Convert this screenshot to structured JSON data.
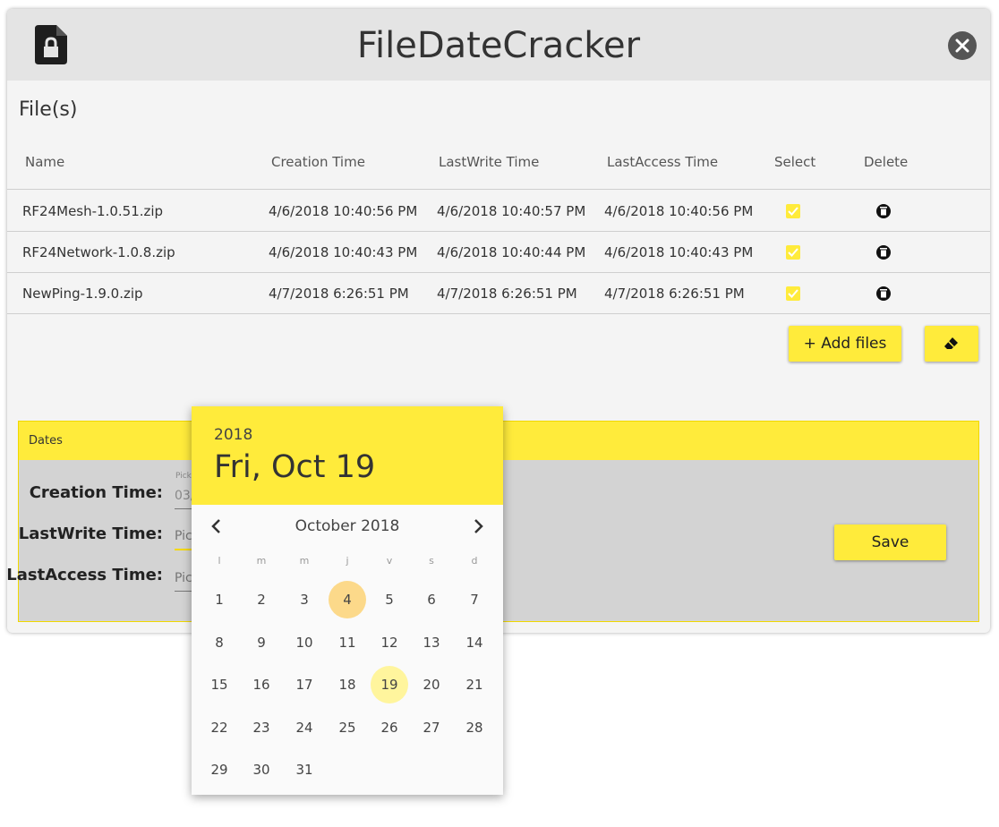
{
  "app": {
    "title": "FileDateCracker"
  },
  "files": {
    "title": "File(s)",
    "columns": [
      "Name",
      "Creation Time",
      "LastWrite Time",
      "LastAccess Time",
      "Select",
      "Delete"
    ],
    "rows": [
      {
        "name": "RF24Mesh-1.0.51.zip",
        "creation": "4/6/2018 10:40:56 PM",
        "lastwrite": "4/6/2018 10:40:57 PM",
        "lastaccess": "4/6/2018 10:40:56 PM",
        "selected": true
      },
      {
        "name": "RF24Network-1.0.8.zip",
        "creation": "4/6/2018 10:40:43 PM",
        "lastwrite": "4/6/2018 10:40:44 PM",
        "lastaccess": "4/6/2018 10:40:43 PM",
        "selected": true
      },
      {
        "name": "NewPing-1.9.0.zip",
        "creation": "4/7/2018 6:26:51 PM",
        "lastwrite": "4/7/2018 6:26:51 PM",
        "lastaccess": "4/7/2018 6:26:51 PM",
        "selected": true
      }
    ],
    "add_label": "+ Add files"
  },
  "dates": {
    "title": "Dates",
    "creation_label": "Creation Time:",
    "creation_hint": "Pick",
    "creation_value": "03/",
    "lastwrite_label": "LastWrite Time:",
    "lastwrite_placeholder": "Pic",
    "lastaccess_label": "LastAccess Time:",
    "lastaccess_placeholder": "Pic",
    "save_label": "Save"
  },
  "picker": {
    "year": "2018",
    "date": "Fri, Oct 19",
    "month": "October 2018",
    "weekdays": [
      "l",
      "m",
      "m",
      "j",
      "v",
      "s",
      "d"
    ],
    "days": [
      1,
      2,
      3,
      4,
      5,
      6,
      7,
      8,
      9,
      10,
      11,
      12,
      13,
      14,
      15,
      16,
      17,
      18,
      19,
      20,
      21,
      22,
      23,
      24,
      25,
      26,
      27,
      28,
      29,
      30,
      31
    ],
    "first_weekday_index": 0,
    "today": 4,
    "selected": 19
  },
  "colors": {
    "accent": "#ffeb3b",
    "today": "#fcd98a",
    "selected": "#fff59d"
  },
  "icons": {
    "app": "file-lock-icon",
    "close": "close-circle-icon",
    "delete": "trash-icon",
    "clear": "eraser-icon",
    "prev": "chevron-left-icon",
    "next": "chevron-right-icon"
  }
}
